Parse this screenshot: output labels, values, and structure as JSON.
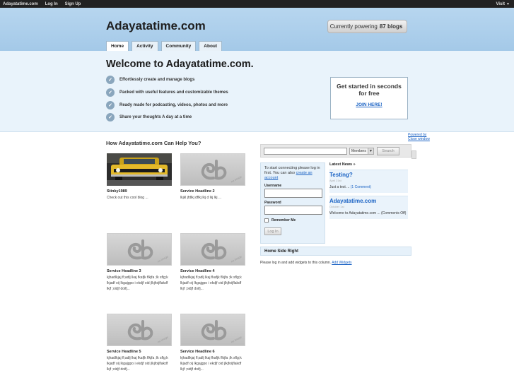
{
  "adminbar": {
    "site": "Adayatatime.com",
    "login": "Log In",
    "signup": "Sign Up",
    "visit": "Visit"
  },
  "header": {
    "title": "Adayatatime.com",
    "powering_prefix": "Currently powering",
    "powering_count": "87 blogs",
    "tabs": [
      "Home",
      "Activity",
      "Community",
      "About"
    ]
  },
  "welcome": {
    "title": "Welcome to Adayatatime.com.",
    "features": [
      "Effortlessly create and manage blogs",
      "Packed with useful features and customizable themes",
      "Ready made for podcasting, videos, photos and more",
      "Share your thoughts A day at a time"
    ],
    "signup_heading": "Get started in seconds for free",
    "signup_link": "JOIN HERE!"
  },
  "powered_by": {
    "line1": "Powered by",
    "line2": "Close window"
  },
  "help": {
    "title": "How Adayatatime.com Can Help You?",
    "cards": [
      {
        "title": "Stinky1989",
        "text": "Check out this cool blog ..."
      },
      {
        "title": "Service Headline 2",
        "text": "lkjkl jfdlkj dflkj lkj d lkj lkj ..."
      },
      {
        "title": "Service Headline 3",
        "text": "kjhadlkjaj fl;adlj lkaj fkafjk flkjfa ;lk sflg;k lkjadf oij lkgajgpo i ekdjf oid jlkjfoijflakdf lkjf ;oidjf doifj..."
      },
      {
        "title": "Service Headline 4",
        "text": "kjhadlkjaj fl;adlj lkaj fkafjk flkjfa ;lk sflg;k lkjadf oij lkgajgpo i ekdjf oid jlkjfoijflakdf lkjf ;oidjf doifj..."
      },
      {
        "title": "Service Headline 5",
        "text": "kjhadlkjaj fl;adlj lkaj fkafjk flkjfa ;lk sflg;k lkjadf oij lkgajgpo i ekdjf oid jlkjfoijflakdf lkjf ;oidjf doifj..."
      },
      {
        "title": "Service Headline 6",
        "text": "kjhadlkjaj fl;adlj lkaj fkafjk flkjfa ;lk sflg;k lkjadf oij lkgajgpo i ekdjf oid jlkjfoijflakdf lkjf ;oidjf doifj..."
      }
    ]
  },
  "search": {
    "select_value": "Members",
    "button": "Search"
  },
  "login": {
    "intro": "To start connecting please log in first. You can also",
    "intro_link": "create an account",
    "username_label": "Username",
    "password_label": "Password",
    "remember": "Remember Me",
    "button": "Log In"
  },
  "news": {
    "heading": "Latest News »",
    "items": [
      {
        "title": "Testing?",
        "date": "April 21st",
        "summary": "Just a test ...",
        "comments": "(1 Comment)"
      },
      {
        "title": "Adayatatime.com",
        "date": "October 1st",
        "summary": "Welcome to Adayatatime.com ...",
        "comments": "(Comments Off)"
      }
    ]
  },
  "sidebar_right": {
    "title": "Home Side Right",
    "note": "Please log in and add widgets to this column.",
    "note_link": "Add Widgets"
  },
  "colors": {
    "header_bg": "#a4c9e8",
    "welcome_bg": "#e9f3fb",
    "link": "#1b63c4",
    "adminbar": "#222222"
  }
}
